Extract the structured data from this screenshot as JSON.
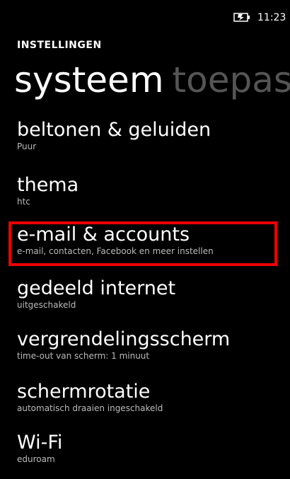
{
  "status_bar": {
    "time": "11:23",
    "battery_icon": "battery-charging-icon"
  },
  "header": {
    "app_title": "INSTELLINGEN",
    "pivot_active": "systeem",
    "pivot_next": "toepas"
  },
  "settings": {
    "items": [
      {
        "title": "beltonen & geluiden",
        "subtitle": "Puur"
      },
      {
        "title": "thema",
        "subtitle": "htc"
      },
      {
        "title": "e-mail & accounts",
        "subtitle": "e-mail, contacten, Facebook en meer instellen"
      },
      {
        "title": "gedeeld internet",
        "subtitle": "uitgeschakeld"
      },
      {
        "title": "vergrendelingsscherm",
        "subtitle": "time-out van scherm: 1 minuut"
      },
      {
        "title": "schermrotatie",
        "subtitle": "automatisch draaien ingeschakeld"
      },
      {
        "title": "Wi-Fi",
        "subtitle": "eduroam"
      }
    ]
  },
  "colors": {
    "background": "#000000",
    "foreground": "#ffffff",
    "inactive_pivot": "#555555",
    "highlight": "#ee0000"
  }
}
